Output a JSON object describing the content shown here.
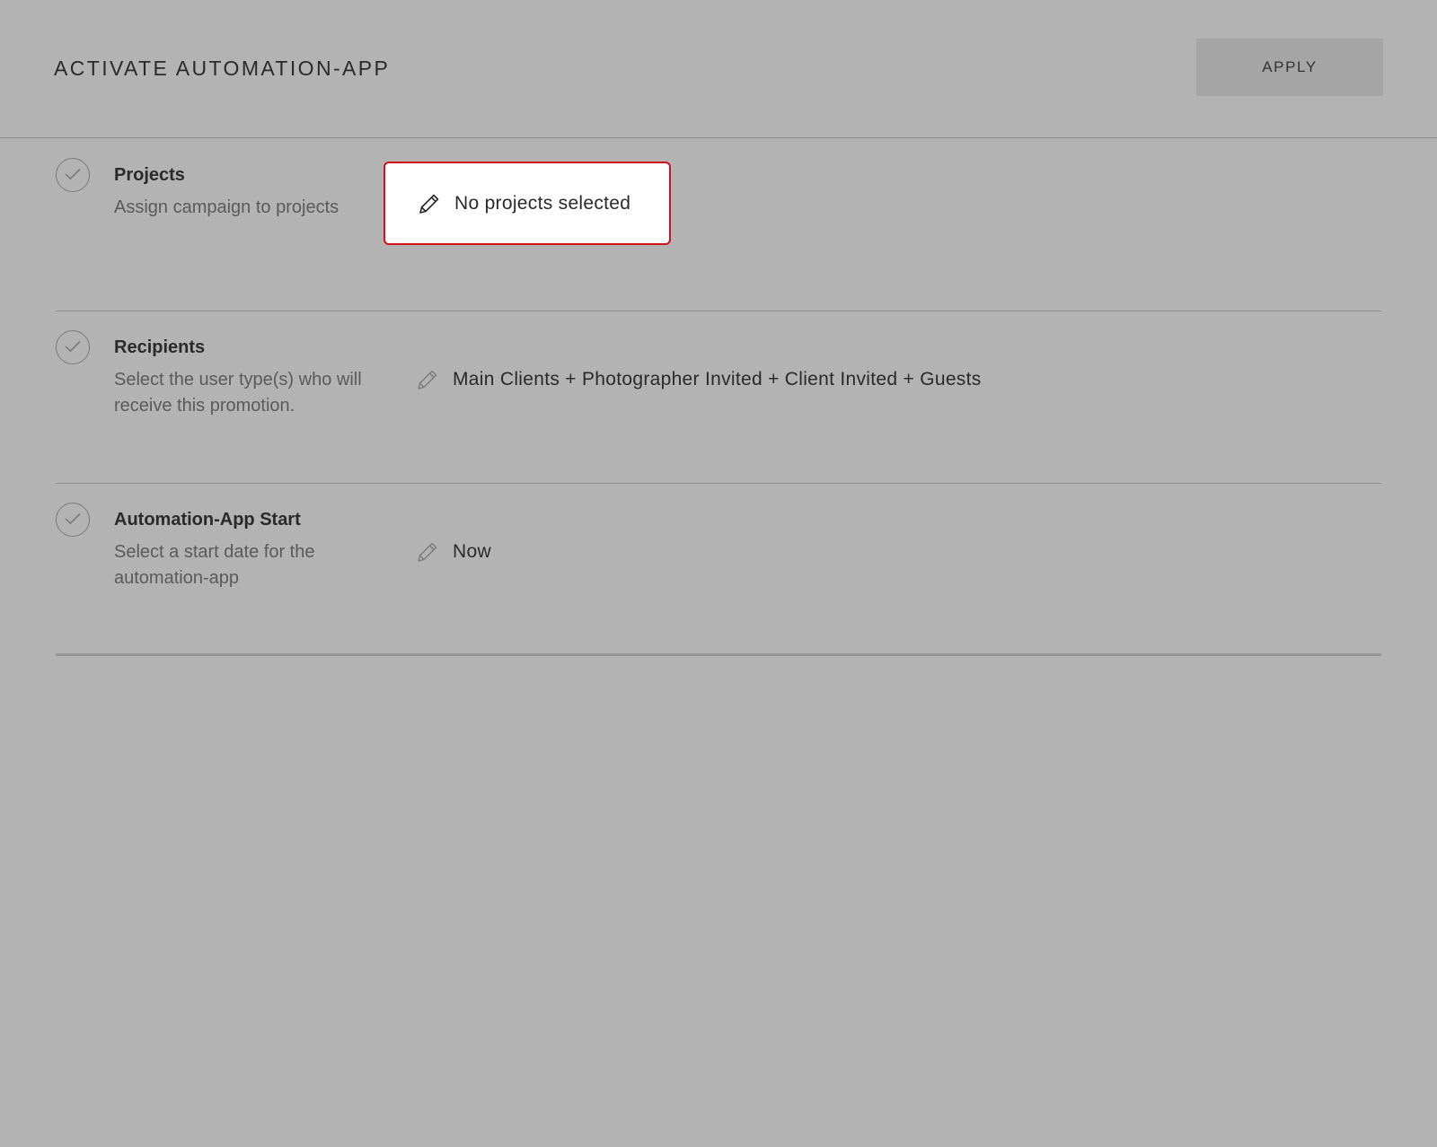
{
  "header": {
    "title": "ACTIVATE AUTOMATION-APP",
    "apply_label": "APPLY"
  },
  "sections": [
    {
      "title": "Projects",
      "description": "Assign campaign to projects",
      "value": "No projects selected",
      "highlighted": true
    },
    {
      "title": "Recipients",
      "description": "Select the user type(s) who will receive this promotion.",
      "value": "Main Clients + Photographer Invited + Client Invited + Guests",
      "highlighted": false
    },
    {
      "title": "Automation-App Start",
      "description": "Select a start date for the automation-app",
      "value": "Now",
      "highlighted": false
    }
  ],
  "icons": {
    "check": "check-circle-icon",
    "edit": "pencil-icon"
  },
  "colors": {
    "background": "#b3b3b3",
    "highlight_border": "#d0121b",
    "highlight_fill": "#ffffff",
    "apply_button": "#a5a5a5"
  }
}
